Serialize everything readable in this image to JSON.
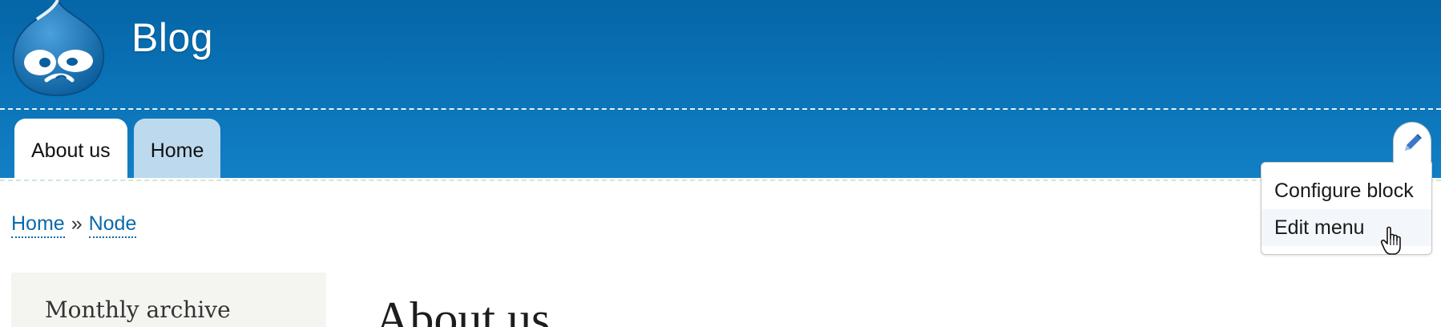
{
  "site": {
    "name": "Blog",
    "logo_icon": "drupal-drop-logo"
  },
  "colors": {
    "header_top": "#0565a7",
    "header_bottom": "#127fc5",
    "link": "#0a6aaa",
    "inactive_tab": "#bdd9ee"
  },
  "tabs": [
    {
      "label": "About us",
      "active": true
    },
    {
      "label": "Home",
      "active": false
    }
  ],
  "breadcrumb": {
    "items": [
      "Home",
      "Node"
    ],
    "separator": "»"
  },
  "sidebar": {
    "block_title": "Monthly archive"
  },
  "node": {
    "title": "About us"
  },
  "contextual": {
    "trigger_icon": "pencil-icon",
    "items": [
      {
        "label": "Configure block"
      },
      {
        "label": "Edit menu"
      }
    ],
    "hovered_index": 1
  },
  "cursor": {
    "type": "pointer-hand-icon"
  }
}
